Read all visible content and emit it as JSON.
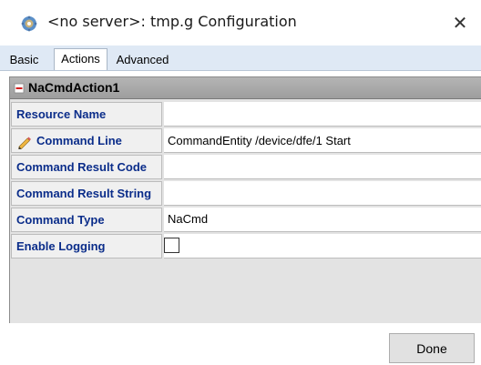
{
  "window": {
    "title": "<no server>: tmp.g Configuration",
    "close_glyph": "✕",
    "app_icon": "gear-globe-icon"
  },
  "tabs": [
    {
      "label": "Basic",
      "active": false
    },
    {
      "label": "Actions",
      "active": true
    },
    {
      "label": "Advanced",
      "active": false
    }
  ],
  "section": {
    "title": "NaCmdAction1",
    "icon": "remove-icon"
  },
  "properties": {
    "resource_name": {
      "label": "Resource Name",
      "value": ""
    },
    "command_line": {
      "label": "Command Line",
      "value": "CommandEntity /device/dfe/1 Start",
      "icon": "pencil-icon"
    },
    "command_result_code": {
      "label": "Command Result Code",
      "value": ""
    },
    "command_result_string": {
      "label": "Command Result String",
      "value": ""
    },
    "command_type": {
      "label": "Command Type",
      "value": "NaCmd"
    },
    "enable_logging": {
      "label": "Enable Logging",
      "checked": false
    }
  },
  "footer": {
    "done_label": "Done"
  },
  "colors": {
    "label_text": "#0b2d8a",
    "tab_strip": "#dfe9f5",
    "header_bg": "#a9a9a9"
  }
}
